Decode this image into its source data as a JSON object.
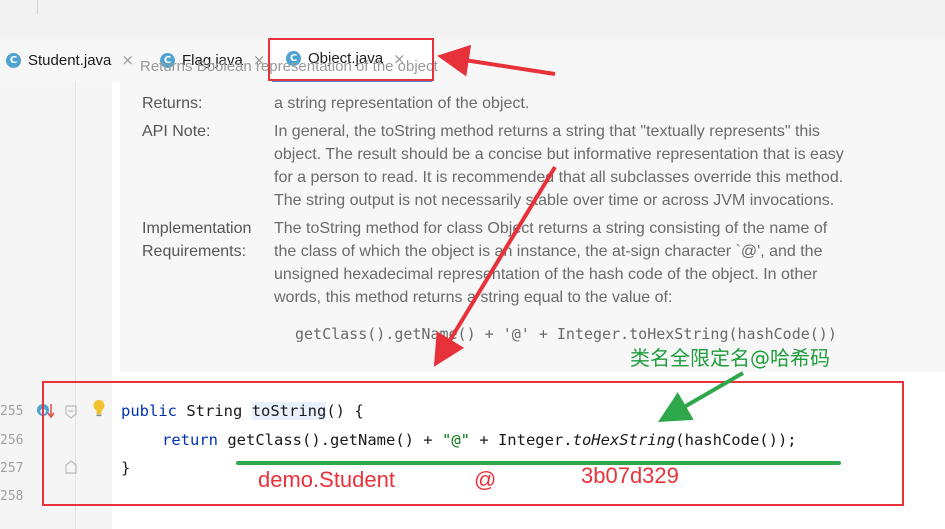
{
  "tabs": [
    {
      "label": "Student.java",
      "active": false
    },
    {
      "label": "Flag.java",
      "active": false
    },
    {
      "label": "Object.java",
      "active": true
    }
  ],
  "tab_close_glyph": "×",
  "doc": {
    "cut_line": "Returns Boolean representation of the object",
    "returns_label": "Returns:",
    "returns_text": "a string representation of the object.",
    "api_note_label": "API Note:",
    "api_note_lines": [
      "In general, the toString method returns a string that \"textually represents\" this",
      "object. The result should be a concise but informative representation that is easy",
      "for a person to read. It is recommended that all subclasses override this method.",
      "The string output is not necessarily stable over time or across JVM invocations."
    ],
    "impl_label_1": "Implementation",
    "impl_label_2": "Requirements:",
    "impl_lines": [
      "The toString method for class Object returns a string consisting of the name of",
      "the class of which the object is an instance, the at-sign character `@', and the",
      "unsigned hexadecimal representation of the hash code of the object. In other",
      "words, this method returns a string equal to the value of:"
    ],
    "code_sample": "getClass().getName() + '@' + Integer.toHexString(hashCode())"
  },
  "code": {
    "line_numbers": [
      "255",
      "256",
      "257",
      "258"
    ],
    "line1_kw": "public",
    "line1_type": "String",
    "line1_method": "toString",
    "line1_rest": "() {",
    "line2_kw": "return",
    "line2_a": "getClass().getName() + ",
    "line2_str": "\"@\"",
    "line2_b": " + Integer.",
    "line2_ital": "toHexString",
    "line2_c": "(hashCode());",
    "line3": "}"
  },
  "annotations": {
    "green_note": "类名全限定名@哈希码",
    "red_class": "demo.Student",
    "red_at": "@",
    "red_hash": "3b07d329"
  },
  "colors": {
    "annotation_red": "#e8323b",
    "annotation_green": "#1f9d3c",
    "keyword": "#0033b3",
    "string": "#067d17",
    "tab_accent": "#4b88d6"
  }
}
